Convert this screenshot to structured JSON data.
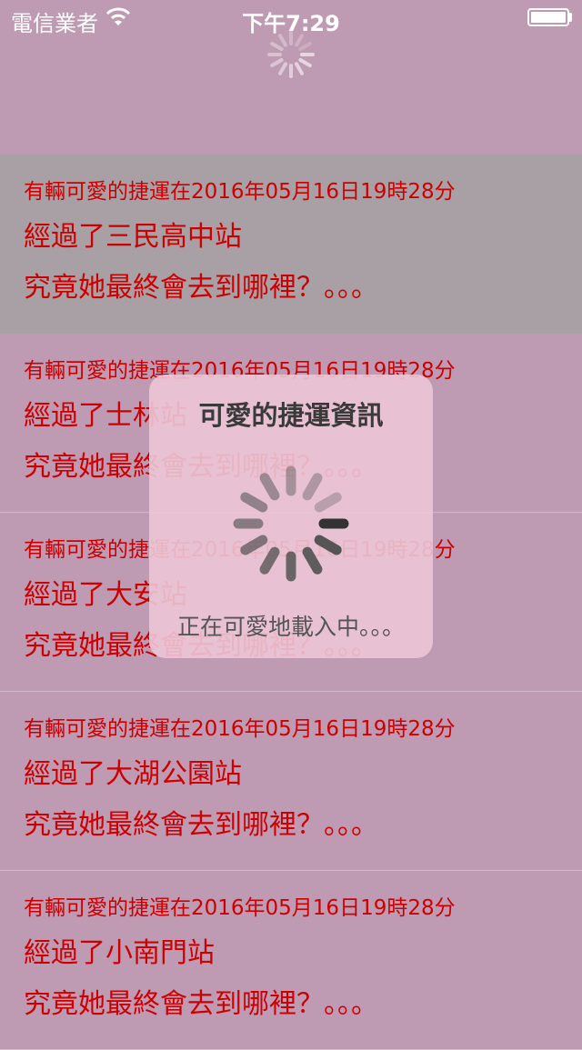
{
  "status_bar": {
    "carrier": "電信業者",
    "time": "下午7:29",
    "wifi_icon": "wifi-icon",
    "battery_icon": "battery-full-icon"
  },
  "list": {
    "rows": [
      {
        "line1": "有輛可愛的捷運在2016年05月16日19時28分",
        "line2": "經過了三民高中站",
        "line3": "究竟她最終會去到哪裡？。。。",
        "selected": true
      },
      {
        "line1": "有輛可愛的捷運在2016年05月16日19時28分",
        "line2": "經過了士林站",
        "line3": "究竟她最終會去到哪裡？。。。",
        "selected": false
      },
      {
        "line1": "有輛可愛的捷運在2016年05月16日19時28分",
        "line2": "經過了大安站",
        "line3": "究竟她最終會去到哪裡？。。。",
        "selected": false
      },
      {
        "line1": "有輛可愛的捷運在2016年05月16日19時28分",
        "line2": "經過了大湖公園站",
        "line3": "究竟她最終會去到哪裡？。。。",
        "selected": false
      },
      {
        "line1": "有輛可愛的捷運在2016年05月16日19時28分",
        "line2": "經過了小南門站",
        "line3": "究竟她最終會去到哪裡？。。。",
        "selected": false
      }
    ]
  },
  "hud": {
    "title": "可愛的捷運資訊",
    "message": "正在可愛地載入中。。。",
    "spinner_icon": "activity-spinner-icon"
  },
  "colors": {
    "background": "#bf9ab3",
    "selected_row": "#a8a0a5",
    "row_text": "#cc0000",
    "hud_background": "#ecc7d6"
  }
}
